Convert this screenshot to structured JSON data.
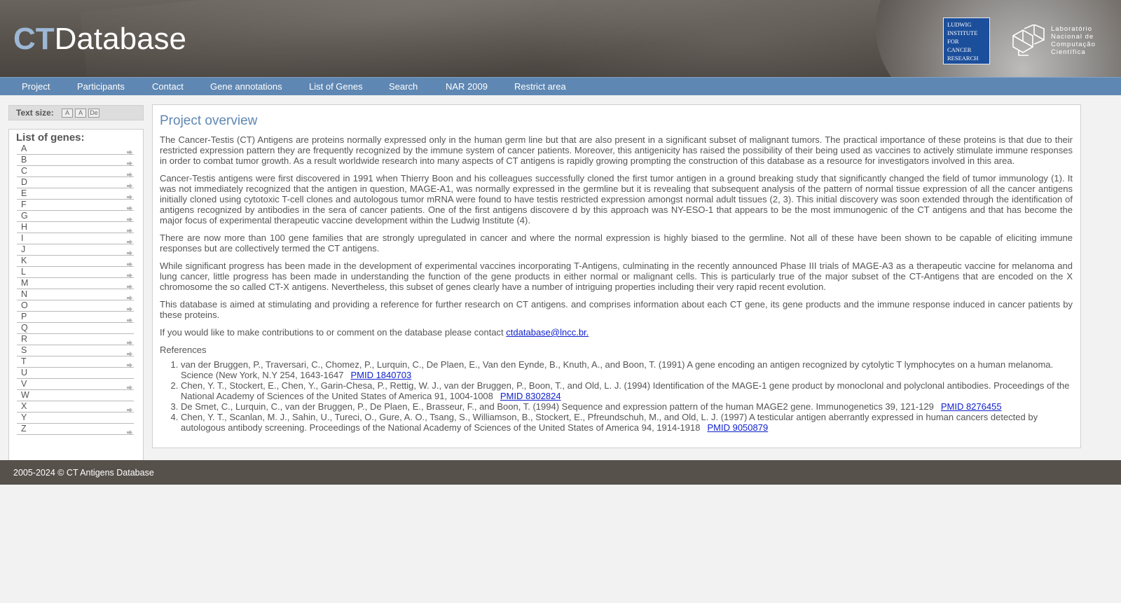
{
  "header": {
    "title_ct": "CT",
    "title_rest": "Database",
    "ludwig_logo_lines": [
      "LUDWIG",
      "INSTITUTE",
      "FOR",
      "CANCER",
      "RESEARCH"
    ],
    "lncc_logo_lines": [
      "Laboratório",
      "Nacional de",
      "Computação",
      "Científica"
    ]
  },
  "nav": {
    "items": [
      "Project",
      "Participants",
      "Contact",
      "Gene annotations",
      "List of Genes",
      "Search",
      "NAR 2009",
      "Restrict area"
    ]
  },
  "text_size": {
    "label": "Text size:",
    "buttons": [
      "A",
      "A",
      "De"
    ]
  },
  "genes": {
    "title": "List of genes:",
    "letters": [
      {
        "letter": "A",
        "has_arrow": true
      },
      {
        "letter": "B",
        "has_arrow": true
      },
      {
        "letter": "C",
        "has_arrow": true
      },
      {
        "letter": "D",
        "has_arrow": true
      },
      {
        "letter": "E",
        "has_arrow": true
      },
      {
        "letter": "F",
        "has_arrow": true
      },
      {
        "letter": "G",
        "has_arrow": true
      },
      {
        "letter": "H",
        "has_arrow": true
      },
      {
        "letter": "I",
        "has_arrow": true
      },
      {
        "letter": "J",
        "has_arrow": true
      },
      {
        "letter": "K",
        "has_arrow": true
      },
      {
        "letter": "L",
        "has_arrow": true
      },
      {
        "letter": "M",
        "has_arrow": true
      },
      {
        "letter": "N",
        "has_arrow": true
      },
      {
        "letter": "O",
        "has_arrow": true
      },
      {
        "letter": "P",
        "has_arrow": true
      },
      {
        "letter": "Q",
        "has_arrow": false
      },
      {
        "letter": "R",
        "has_arrow": true
      },
      {
        "letter": "S",
        "has_arrow": true
      },
      {
        "letter": "T",
        "has_arrow": true
      },
      {
        "letter": "U",
        "has_arrow": false
      },
      {
        "letter": "V",
        "has_arrow": true
      },
      {
        "letter": "W",
        "has_arrow": false
      },
      {
        "letter": "X",
        "has_arrow": true
      },
      {
        "letter": "Y",
        "has_arrow": false
      },
      {
        "letter": "Z",
        "has_arrow": true
      }
    ]
  },
  "main": {
    "title": "Project overview",
    "paragraphs": [
      "The Cancer-Testis (CT) Antigens are proteins normally expressed only in the human germ line but that are also present in a significant subset of malignant tumors. The practical importance of these proteins is that due to their restricted expression pattern they are frequently recognized by the immune system of cancer patients. Moreover, this antigenicity has raised the possibility of their being used as vaccines to actively stimulate immune responses in order to combat tumor growth. As a result worldwide research into many aspects of CT antigens is rapidly growing prompting the construction of this database as a resource for investigators involved in this area.",
      "Cancer-Testis antigens were first discovered in 1991 when Thierry Boon and his colleagues successfully cloned the first tumor antigen in a ground breaking study that significantly changed the field of tumor immunology (1). It was not immediately recognized that the antigen in question, MAGE-A1, was normally expressed in the germline but it is revealing that subsequent analysis of the pattern of normal tissue expression of all the cancer antigens initially cloned using cytotoxic T-cell clones and autologous tumor mRNA were found to have testis restricted expression amongst normal adult tissues (2, 3). This initial discovery was soon extended through the identification of antigens recognized by antibodies in the sera of cancer patients. One of the first antigens discovere d by this approach was NY-ESO-1 that appears to be the most immunogenic of the CT antigens and that has become the major focus of experimental therapeutic vaccine development within the Ludwig Institute (4).",
      "There are now more than 100 gene families that are strongly upregulated in cancer and where the normal expression is highly biased to the germline. Not all of these have been shown to be capable of eliciting immune responses but are collectively termed the CT antigens.",
      "While significant progress has been made in the development of experimental vaccines incorporating T-Antigens, culminating in the recently announced Phase III trials of MAGE-A3 as a therapeutic vaccine for melanoma and lung cancer, little progress has been made in understanding the function of the gene products in either normal or malignant cells. This is particularly true of the major subset of the CT-Antigens that are encoded on the X chromosome the so called CT-X antigens. Nevertheless, this subset of genes clearly have a number of intriguing properties including their very rapid recent evolution.",
      "This database is aimed at stimulating and providing a reference for further research on CT antigens. and comprises information about each CT gene, its gene products and the immune response induced in cancer patients by these proteins."
    ],
    "contact_text": "If you would like to make contributions to or comment on the database please contact",
    "contact_email": "ctdatabase@lncc.br.",
    "references_label": "References",
    "references": [
      {
        "text": "van der Bruggen, P., Traversari, C., Chomez, P., Lurquin, C., De Plaen, E., Van den Eynde, B., Knuth, A., and Boon, T. (1991) A gene encoding an antigen recognized by cytolytic T lymphocytes on a human melanoma. Science (New York, N.Y 254, 1643-1647",
        "pmid": "PMID 1840703"
      },
      {
        "text": "Chen, Y. T., Stockert, E., Chen, Y., Garin-Chesa, P., Rettig, W. J., van der Bruggen, P., Boon, T., and Old, L. J. (1994) Identification of the MAGE-1 gene product by monoclonal and polyclonal antibodies. Proceedings of the National Academy of Sciences of the United States of America 91, 1004-1008",
        "pmid": "PMID 8302824"
      },
      {
        "text": "De Smet, C., Lurquin, C., van der Bruggen, P., De Plaen, E., Brasseur, F., and Boon, T. (1994) Sequence and expression pattern of the human MAGE2 gene. Immunogenetics 39, 121-129",
        "pmid": "PMID 8276455"
      },
      {
        "text": "Chen, Y. T., Scanlan, M. J., Sahin, U., Tureci, O., Gure, A. O., Tsang, S., Williamson, B., Stockert, E., Pfreundschuh, M., and Old, L. J. (1997) A testicular antigen aberrantly expressed in human cancers detected by autologous antibody screening. Proceedings of the National Academy of Sciences of the United States of America 94, 1914-1918",
        "pmid": "PMID 9050879"
      }
    ]
  },
  "footer": {
    "text": "2005-2024 © CT Antigens Database"
  },
  "colors": {
    "nav_bg": "#5f87b3",
    "title_blue": "#5f87b3",
    "header_bg": "#57514b",
    "link": "#1122cc"
  }
}
